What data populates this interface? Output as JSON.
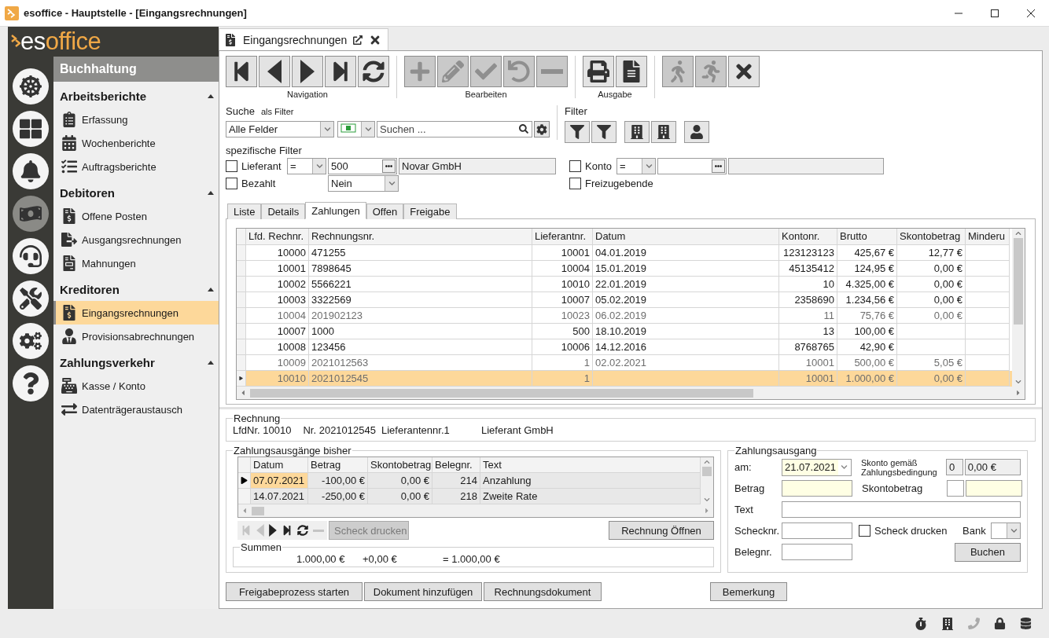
{
  "window": {
    "title": "esoffice - Hauptstelle - [Eingangsrechnungen]"
  },
  "logo": {
    "prefix": "es",
    "suffix": "office"
  },
  "rail": [
    {
      "selected": false
    },
    {
      "selected": false
    },
    {
      "selected": false
    },
    {
      "selected": true
    },
    {
      "selected": false
    },
    {
      "selected": false
    },
    {
      "selected": false
    },
    {
      "selected": false
    }
  ],
  "nav": {
    "header": "Buchhaltung",
    "sections": [
      {
        "title": "Arbeitsberichte",
        "expanded": true,
        "items": [
          {
            "label": "Erfassung",
            "selected": false
          },
          {
            "label": "Wochenberichte",
            "selected": false
          },
          {
            "label": "Auftragsberichte",
            "selected": false
          }
        ]
      },
      {
        "title": "Debitoren",
        "expanded": true,
        "items": [
          {
            "label": "Offene Posten",
            "selected": false
          },
          {
            "label": "Ausgangsrechnungen",
            "selected": false
          },
          {
            "label": "Mahnungen",
            "selected": false
          }
        ]
      },
      {
        "title": "Kreditoren",
        "expanded": true,
        "items": [
          {
            "label": "Eingangsrechnungen",
            "selected": true
          },
          {
            "label": "Provisionsabrechnungen",
            "selected": false
          }
        ]
      },
      {
        "title": "Zahlungsverkehr",
        "expanded": true,
        "items": [
          {
            "label": "Kasse / Konto",
            "selected": false
          },
          {
            "label": "Datenträgeraustausch",
            "selected": false
          }
        ]
      }
    ]
  },
  "document_tab": {
    "label": "Eingangsrechnungen"
  },
  "toolbar": [
    {
      "label": "Navigation",
      "buttons": [
        {
          "disabled": false
        },
        {
          "disabled": false
        },
        {
          "disabled": false
        },
        {
          "disabled": false
        },
        {
          "disabled": false
        }
      ]
    },
    {
      "label": "Bearbeiten",
      "buttons": [
        {
          "disabled": true
        },
        {
          "disabled": true
        },
        {
          "disabled": true
        },
        {
          "disabled": true
        },
        {
          "disabled": true
        }
      ]
    },
    {
      "label": "Ausgabe",
      "buttons": [
        {
          "disabled": false
        },
        {
          "disabled": false
        }
      ]
    },
    {
      "buttons": [
        {
          "disabled": true
        },
        {
          "disabled": true
        },
        {
          "disabled": false
        }
      ]
    }
  ],
  "search": {
    "label": "Suche",
    "mode": "als Filter",
    "field": "Alle Felder",
    "placeholder": "Suchen ..."
  },
  "filter": {
    "label": "Filter"
  },
  "specific_filters": {
    "label": "spezifische Filter",
    "items": [
      {
        "kind": "lookup",
        "label": "Lieferant",
        "checked": false,
        "operator": "=",
        "value": "500",
        "name": "Novar GmbH"
      },
      {
        "kind": "lookup",
        "label": "Konto",
        "checked": false,
        "operator": "="
      },
      {
        "kind": "select",
        "label": "Bezahlt",
        "checked": false,
        "value": "Nein"
      },
      {
        "kind": "check",
        "label": "Freizugebende",
        "checked": false
      }
    ]
  },
  "tabs": [
    {
      "label": "Liste",
      "selected": false
    },
    {
      "label": "Details",
      "selected": false
    },
    {
      "label": "Zahlungen",
      "selected": true
    },
    {
      "label": "Offen",
      "selected": false
    },
    {
      "label": "Freigabe",
      "selected": false
    }
  ],
  "invoices": {
    "columns": [
      {
        "label": "Lfd. Rechnr.",
        "kind": "number"
      },
      {
        "label": "Rechnungsnr.",
        "kind": "text"
      },
      {
        "label": "Lieferantnr.",
        "kind": "number"
      },
      {
        "label": "Datum",
        "kind": "text"
      },
      {
        "label": "Kontonr.",
        "kind": "number"
      },
      {
        "label": "Brutto",
        "kind": "number"
      },
      {
        "label": "Skontobetrag",
        "kind": "number"
      },
      {
        "label": "Minderu"
      }
    ],
    "rows": [
      {
        "cells": [
          "10000",
          "471255",
          "10001",
          "04.01.2019",
          "123123123",
          "425,67 €",
          "12,77 €"
        ],
        "muted": false,
        "selected": false
      },
      {
        "cells": [
          "10001",
          "7898645",
          "10004",
          "15.01.2019",
          "45135412",
          "124,95 €",
          "0,00 €"
        ],
        "muted": false,
        "selected": false
      },
      {
        "cells": [
          "10002",
          "5566221",
          "10010",
          "22.01.2019",
          "10",
          "4.325,00 €",
          "0,00 €"
        ],
        "muted": false,
        "selected": false
      },
      {
        "cells": [
          "10003",
          "3322569",
          "10007",
          "05.02.2019",
          "2358690",
          "1.234,56 €",
          "0,00 €"
        ],
        "muted": false,
        "selected": false
      },
      {
        "cells": [
          "10004",
          "201902123",
          "10023",
          "06.02.2019",
          "11",
          "75,76 €",
          "0,00 €"
        ],
        "muted": true,
        "selected": false
      },
      {
        "cells": [
          "10007",
          "1000",
          "500",
          "18.10.2019",
          "13",
          "100,00 €",
          null
        ],
        "muted": false,
        "selected": false
      },
      {
        "cells": [
          "10008",
          "123456",
          "10006",
          "14.12.2016",
          "8768765",
          "42,90 €",
          null
        ],
        "muted": false,
        "selected": false
      },
      {
        "cells": [
          "10009",
          "2021012563",
          "1",
          "02.02.2021",
          "10001",
          "500,00 €",
          "5,05 €"
        ],
        "muted": true,
        "selected": false
      },
      {
        "cells": [
          "10010",
          "2021012545",
          "1",
          null,
          "10001",
          "1.000,00 €",
          "0,00 €"
        ],
        "muted": true,
        "selected": true
      }
    ]
  },
  "invoice_info": {
    "legend": "Rechnung",
    "lfd": "LfdNr. 10010",
    "number": "Nr. 2021012545",
    "supplier_no": "Lieferantennr.1",
    "supplier": "Lieferant GmbH"
  },
  "payments": {
    "legend": "Zahlungsausgänge bisher",
    "columns": [
      {
        "label": "Datum",
        "kind": "text"
      },
      {
        "label": "Betrag",
        "kind": "number"
      },
      {
        "label": "Skontobetrag",
        "kind": "number"
      },
      {
        "label": "Belegnr.",
        "kind": "number"
      },
      {
        "label": "Text",
        "kind": "text"
      }
    ],
    "rows": [
      {
        "cells": [
          "07.07.2021",
          "-100,00 €",
          "0,00 €",
          "214",
          "Anzahlung"
        ],
        "selected": true
      },
      {
        "cells": [
          "14.07.2021",
          "-250,00 €",
          "0,00 €",
          "218",
          "Zweite Rate"
        ],
        "selected": false
      }
    ],
    "nav": [
      {
        "disabled": true
      },
      {
        "disabled": true
      },
      {
        "disabled": false
      },
      {
        "disabled": false
      },
      {
        "disabled": false
      },
      {
        "disabled": true
      }
    ],
    "print_button": {
      "label": "Scheck drucken",
      "disabled": true
    },
    "open_button": "Rechnung Öffnen",
    "sums": {
      "legend": "Summen",
      "values": [
        "1.000,00 €",
        "+0,00 €",
        "= 1.000,00 €"
      ]
    }
  },
  "payment_out": {
    "legend": "Zahlungsausgang",
    "date_label": "am:",
    "date": "21.07.2021",
    "terms_label": "Skonto gemäß Zahlungsbedingung",
    "terms_days": "0",
    "terms_amount": "0,00 €",
    "amount_label": "Betrag",
    "discount_label": "Skontobetrag",
    "text_label": "Text",
    "check_no_label": "Schecknr.",
    "print_check": {
      "label": "Scheck drucken",
      "checked": false
    },
    "bank_label": "Bank",
    "voucher_label": "Belegnr.",
    "book_button": "Buchen"
  },
  "actions": [
    "Freigabeprozess starten",
    "Dokument hinzufügen",
    "Rechnungsdokument",
    "Bemerkung"
  ]
}
